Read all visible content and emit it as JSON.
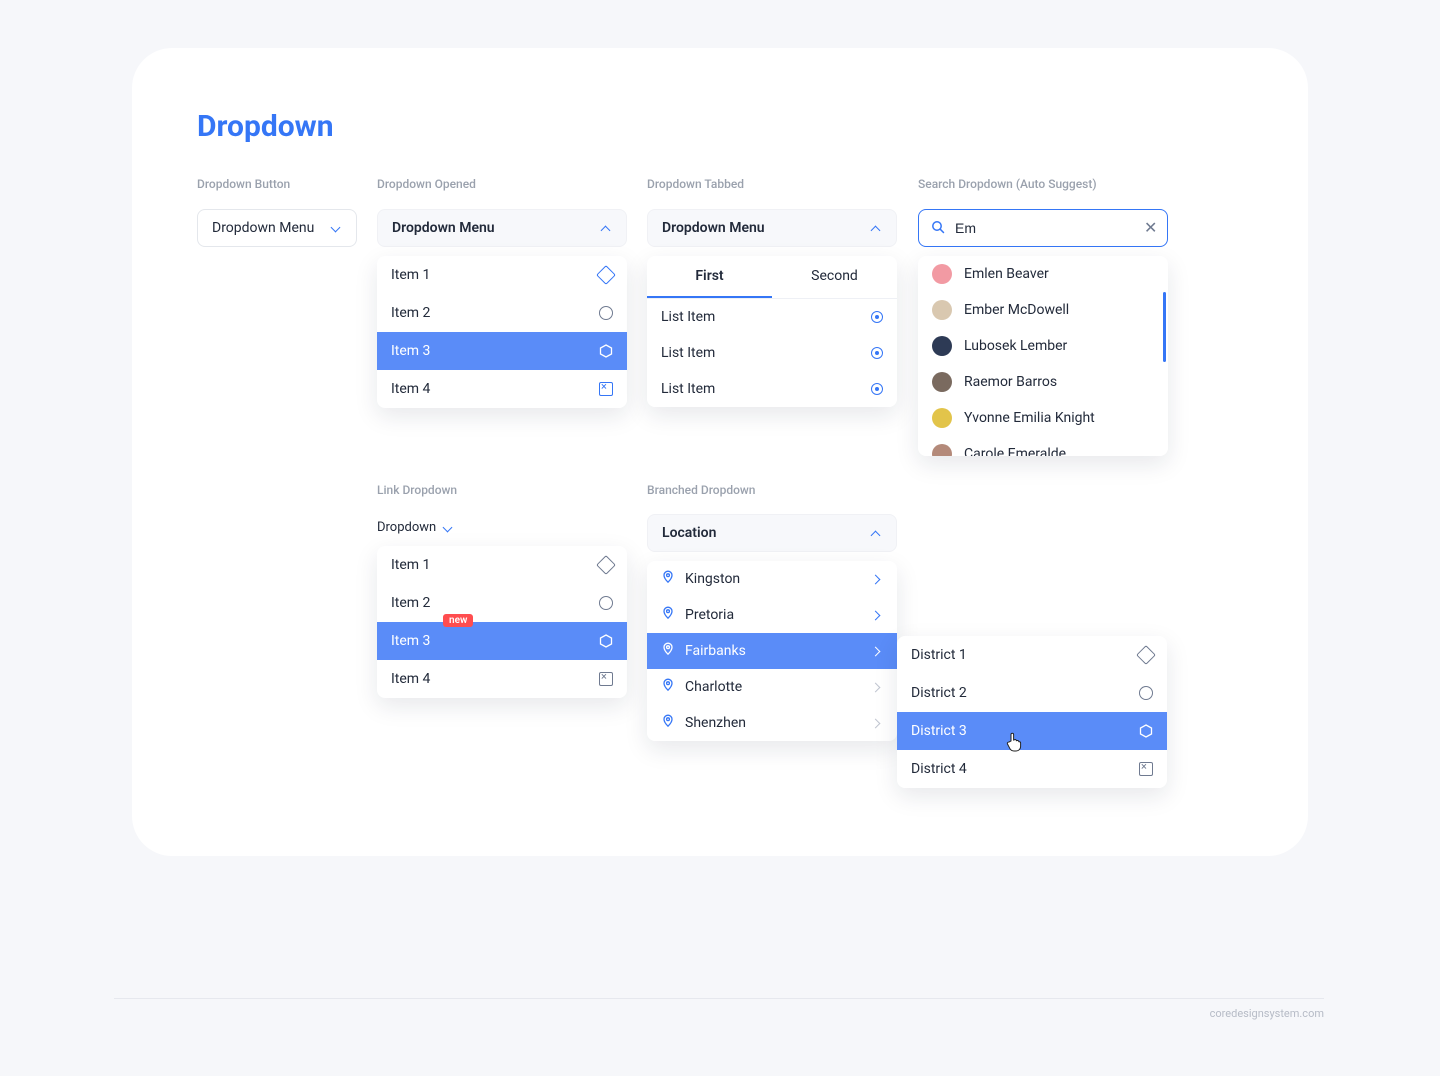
{
  "page_title": "Dropdown",
  "sections": {
    "button": "Dropdown Button",
    "opened": "Dropdown Opened",
    "tabbed": "Dropdown Tabbed",
    "search": "Search Dropdown (Auto Suggest)",
    "link": "Link Dropdown",
    "branched": "Branched Dropdown"
  },
  "button_dd": {
    "label": "Dropdown Menu"
  },
  "opened_dd": {
    "label": "Dropdown Menu",
    "items": [
      {
        "label": "Item 1",
        "selected": false
      },
      {
        "label": "Item 2",
        "selected": false
      },
      {
        "label": "Item 3",
        "selected": true
      },
      {
        "label": "Item 4",
        "selected": false
      }
    ]
  },
  "tabbed_dd": {
    "label": "Dropdown Menu",
    "tabs": [
      {
        "label": "First",
        "active": true
      },
      {
        "label": "Second",
        "active": false
      }
    ],
    "list": [
      {
        "label": "List Item"
      },
      {
        "label": "List Item"
      },
      {
        "label": "List Item"
      }
    ]
  },
  "search_dd": {
    "value": "Em",
    "results": [
      {
        "name": "Emlen Beaver",
        "color": "#f29aa3"
      },
      {
        "name": "Ember McDowell",
        "color": "#d9c8b0"
      },
      {
        "name": "Lubosek Lember",
        "color": "#2d3a55"
      },
      {
        "name": "Raemor Barros",
        "color": "#7a6a5f"
      },
      {
        "name": "Yvonne Emilia Knight",
        "color": "#e2c44a"
      },
      {
        "name": "Carole Emeralde",
        "color": "#b48a7a"
      }
    ]
  },
  "link_dd": {
    "label": "Dropdown",
    "items": [
      {
        "label": "Item 1",
        "selected": false,
        "badge": null
      },
      {
        "label": "Item 2",
        "selected": false,
        "badge": "new"
      },
      {
        "label": "Item 3",
        "selected": true,
        "badge": null
      },
      {
        "label": "Item 4",
        "selected": false,
        "badge": null
      }
    ]
  },
  "branched_dd": {
    "label": "Location",
    "locations": [
      {
        "label": "Kingston",
        "selected": false
      },
      {
        "label": "Pretoria",
        "selected": false
      },
      {
        "label": "Fairbanks",
        "selected": true
      },
      {
        "label": "Charlotte",
        "selected": false
      },
      {
        "label": "Shenzhen",
        "selected": false
      }
    ],
    "districts": [
      {
        "label": "District 1",
        "selected": false
      },
      {
        "label": "District 2",
        "selected": false
      },
      {
        "label": "District 3",
        "selected": true
      },
      {
        "label": "District 4",
        "selected": false
      }
    ]
  },
  "footer": "coredesignsystem.com"
}
